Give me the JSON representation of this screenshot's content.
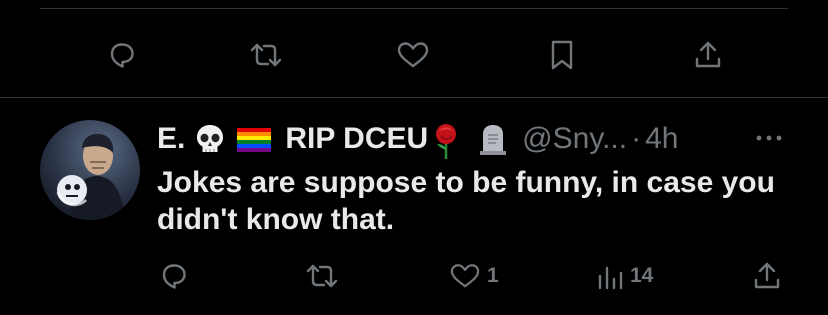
{
  "top_actions": {
    "reply_icon": "reply-icon",
    "retweet_icon": "retweet-icon",
    "like_icon": "heart-icon",
    "bookmark_icon": "bookmark-icon",
    "share_icon": "share-icon"
  },
  "tweet": {
    "author": {
      "name": "E.",
      "name_suffix": "RIP DCEU",
      "emojis": [
        "skull",
        "rainbow-flag",
        "rose",
        "headstone"
      ],
      "handle": "@Sny...",
      "separator": "·",
      "time": "4h"
    },
    "text": "Jokes are suppose to be funny, in case you didn't know that.",
    "actions": {
      "reply_count": "",
      "retweet_count": "",
      "like_count": "1",
      "views_count": "14"
    }
  },
  "colors": {
    "background": "#000000",
    "text": "#e7e9ea",
    "muted": "#71767b",
    "divider": "#2f3336"
  }
}
